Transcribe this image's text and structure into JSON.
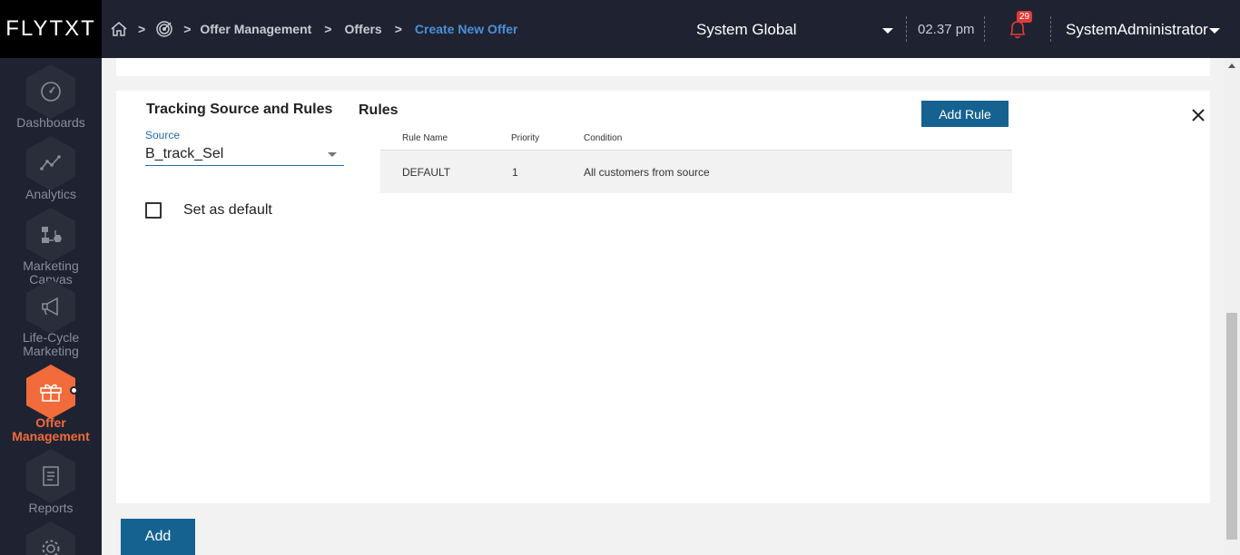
{
  "header": {
    "logo": "FLYTXT",
    "breadcrumbs": [
      "Offer Management",
      "Offers",
      "Create New Offer"
    ],
    "context": "System Global",
    "time": "02.37 pm",
    "notification_count": "29",
    "user": "SystemAdministrator"
  },
  "sidebar": {
    "items": [
      {
        "label": "Dashboards",
        "icon": "gauge-icon"
      },
      {
        "label": "Analytics",
        "icon": "line-chart-icon"
      },
      {
        "label": "Marketing Canvas",
        "icon": "flow-icon"
      },
      {
        "label": "Life-Cycle Marketing",
        "icon": "megaphone-icon"
      },
      {
        "label": "Offer Management",
        "icon": "gift-icon",
        "active": true
      },
      {
        "label": "Reports",
        "icon": "report-icon"
      },
      {
        "label": "",
        "icon": "gear-icon"
      }
    ]
  },
  "tracking": {
    "title": "Tracking Source and Rules",
    "source_label": "Source",
    "source_value": "B_track_Sel",
    "default_checkbox_label": "Set as default"
  },
  "rules": {
    "title": "Rules",
    "add_rule_label": "Add Rule",
    "columns": [
      "Rule Name",
      "Priority",
      "Condition"
    ],
    "rows": [
      [
        "DEFAULT",
        "1",
        "All customers from source"
      ]
    ]
  },
  "footer": {
    "add_label": "Add"
  },
  "colors": {
    "accent": "#f26b3a",
    "primary_button": "#156291",
    "topbar": "#1f2331"
  }
}
